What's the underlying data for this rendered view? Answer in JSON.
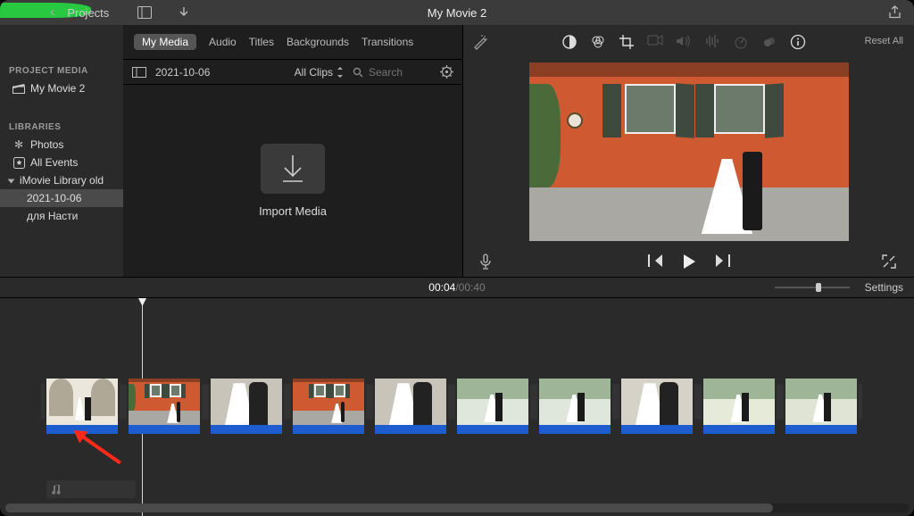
{
  "window": {
    "title": "My Movie 2"
  },
  "titlebar": {
    "back_label": "Projects"
  },
  "sidebar": {
    "project_media_header": "PROJECT MEDIA",
    "project_name": "My Movie 2",
    "libraries_header": "LIBRARIES",
    "photos_label": "Photos",
    "all_events_label": "All Events",
    "library_name": "iMovie Library old",
    "event_selected": "2021-10-06",
    "event_other": "для Насти"
  },
  "tabs": {
    "my_media": "My Media",
    "audio": "Audio",
    "titles": "Titles",
    "backgrounds": "Backgrounds",
    "transitions": "Transitions"
  },
  "browser_toolbar": {
    "event_name": "2021-10-06",
    "filter_label": "All Clips",
    "search_placeholder": "Search"
  },
  "import": {
    "label": "Import Media"
  },
  "viewer": {
    "reset_label": "Reset All"
  },
  "playback": {
    "current_time": "00:04",
    "separator": " / ",
    "total_time": "00:40"
  },
  "timeline": {
    "settings_label": "Settings",
    "zoom_percent": 55,
    "clip_count": 10
  }
}
